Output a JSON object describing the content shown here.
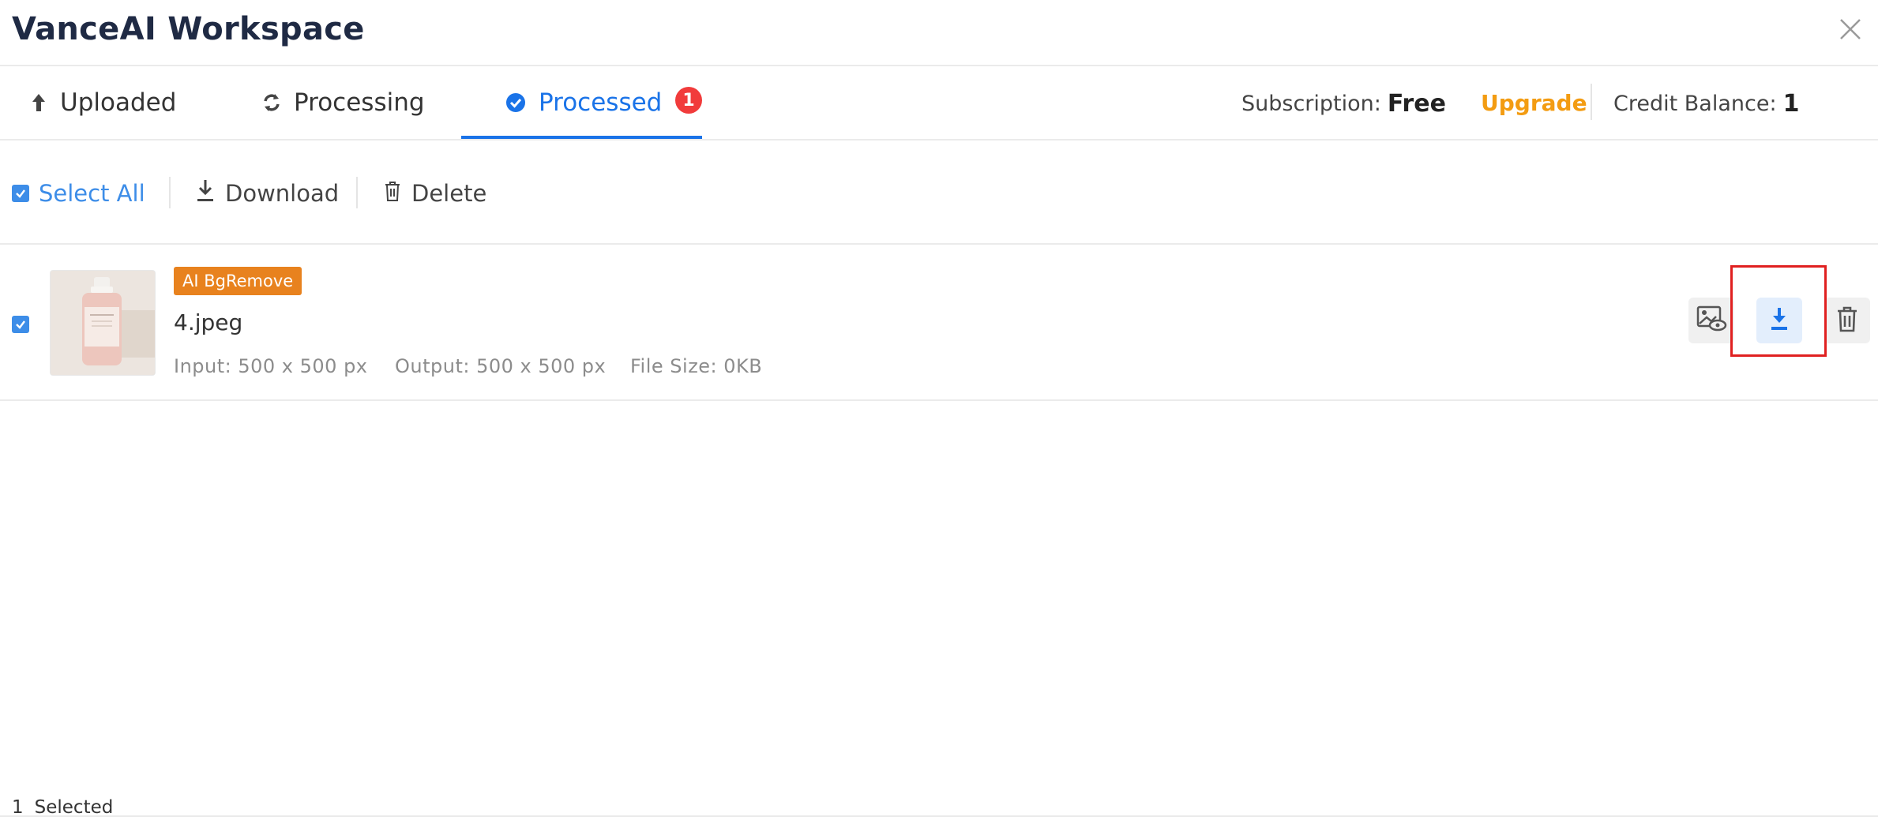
{
  "window": {
    "title": "VanceAI Workspace"
  },
  "tabs": [
    {
      "label": "Uploaded",
      "icon": "arrow-up-icon"
    },
    {
      "label": "Processing",
      "icon": "sync-icon"
    },
    {
      "label": "Processed",
      "icon": "check-circle-icon",
      "badge": "1",
      "active": true
    }
  ],
  "account": {
    "subscription_label": "Subscription:",
    "subscription_value": "Free",
    "upgrade_label": "Upgrade",
    "credit_label": "Credit Balance:",
    "credit_value": "1"
  },
  "toolbar": {
    "select_all": "Select All",
    "download": "Download",
    "delete": "Delete"
  },
  "files": [
    {
      "tag": "AI BgRemove",
      "name": "4.jpeg",
      "input": "Input: 500 x 500 px",
      "output": "Output: 500 x 500 px",
      "size": "File Size: 0KB",
      "checked": true
    }
  ],
  "footer": {
    "count": "1",
    "label": "Selected"
  },
  "colors": {
    "accent": "#1a73e8",
    "upgrade": "#f39c12",
    "tag": "#e8821e",
    "badge": "#f13b3b",
    "highlight": "#e02020"
  }
}
